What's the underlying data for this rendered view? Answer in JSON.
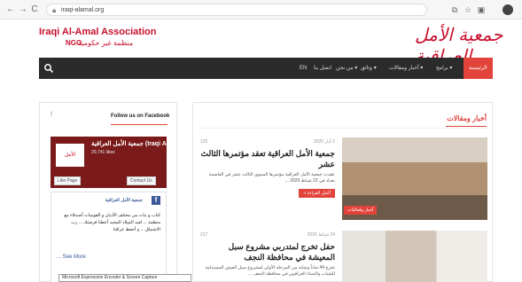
{
  "browser": {
    "back": "←",
    "forward": "→",
    "reload": "C",
    "home": "⌂",
    "url": "iraqi-alamal.org"
  },
  "site": {
    "name_en": "Iraqi Al-Amal Association",
    "ngo": "NGO",
    "ngo_ar": "منظمة غير حكومية",
    "logo_ar": "جمعية الأمل العراقية"
  },
  "nav": {
    "items": [
      {
        "label": "الرئيسية",
        "active": true
      },
      {
        "label": "برامج ▾"
      },
      {
        "label": "أخبار ومقالات ▾"
      },
      {
        "label": "وثائق ▾"
      },
      {
        "label": "من نحن ▾"
      },
      {
        "label": "اتصل بنا"
      },
      {
        "label": "EN"
      }
    ]
  },
  "facebook": {
    "heading": "Follow us on Facebook",
    "f_glyph": "f",
    "page_name": "جمعية الأمل العراقية (Iraqi Ala...",
    "likes": "20,741 likes",
    "like_btn": "Like Page",
    "contact_btn": "Contact Us",
    "post_name": "جمعية الأمل العراقية",
    "post_text": "كتاب و بنات من مختلف الأديان و القوميات أصدقاء مع منظمة ... لعيد الميلاد المجيد أعطنا فرصتك ...  رب الاشتياق ... و أحفظ عراقنا",
    "see_more": "... See More",
    "tooltip": "Microsoft Expression Encoder & Screen Capture"
  },
  "news": {
    "heading": "أخبار ومقالات",
    "articles": [
      {
        "date": "2 آذار 2020",
        "views": "125",
        "title": "جمعية الأمل العراقية تعقد مؤتمرها الثالث عشر",
        "excerpt": "عقدت جمعية الأمل العراقية مؤتمرها السنوي الثالث عشر في العاصمة بغداد في 22 شباط 2020 ...",
        "read_more": "أكمل القراءة »",
        "badge": "أخبار وفعاليات"
      },
      {
        "date": "24 شباط 2020",
        "views": "217",
        "title": "حفل تخرج لمتدربي مشروع سبل المعيشة في محافظة النجف",
        "excerpt": "تخرج 44 شاباً وشابة من المرحلة الأولى لمشروع سبل العيش المستدامة للشباب والنساء العراقيين في محافظة النجف ..."
      }
    ]
  }
}
